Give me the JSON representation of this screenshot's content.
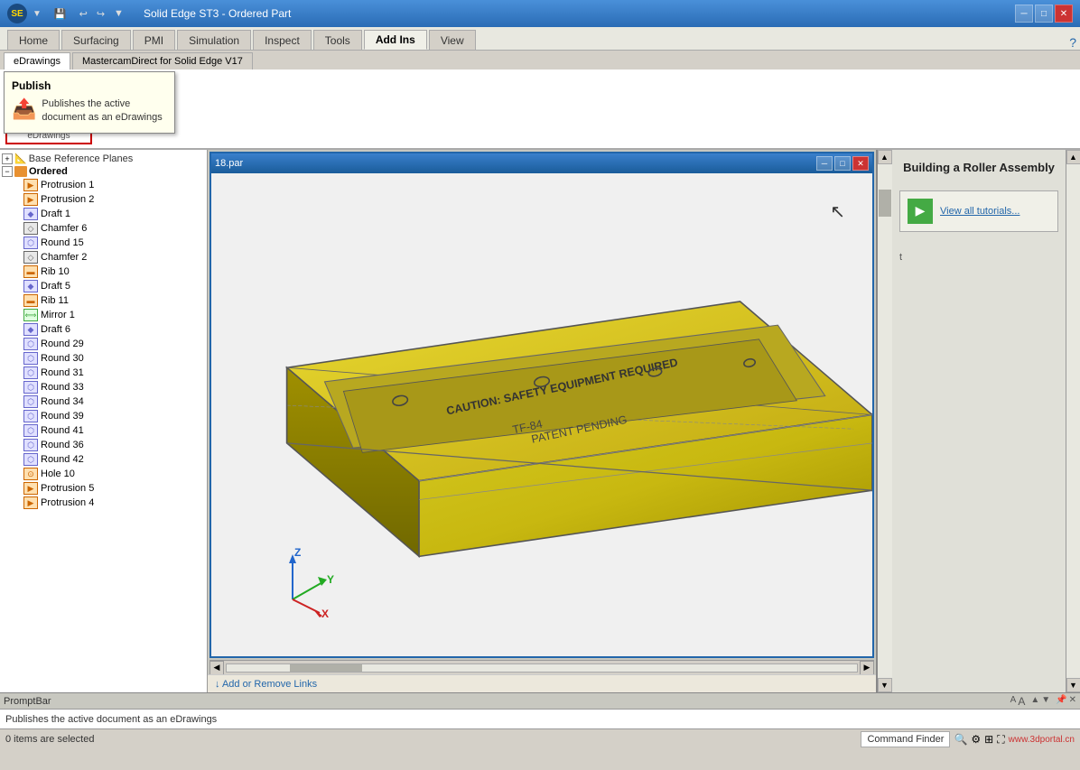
{
  "window": {
    "title": "Solid Edge ST3 - Ordered Part",
    "file_name": "18.par"
  },
  "title_bar": {
    "title": "Solid Edge ST3 - Ordered Part",
    "min_label": "─",
    "max_label": "□",
    "close_label": "✕"
  },
  "quick_access": {
    "save_label": "💾",
    "undo_label": "↩",
    "redo_label": "↪"
  },
  "ribbon": {
    "tabs": [
      {
        "id": "home",
        "label": "Home"
      },
      {
        "id": "surfacing",
        "label": "Surfacing"
      },
      {
        "id": "pmi",
        "label": "PMI"
      },
      {
        "id": "simulation",
        "label": "Simulation"
      },
      {
        "id": "inspect",
        "label": "Inspect"
      },
      {
        "id": "tools",
        "label": "Tools"
      },
      {
        "id": "addins",
        "label": "Add Ins",
        "active": true
      },
      {
        "id": "view",
        "label": "View"
      }
    ]
  },
  "toolbar": {
    "section_tabs": [
      {
        "id": "edrawings",
        "label": "eDrawings",
        "active": true
      },
      {
        "id": "mastercam",
        "label": "MastercamDirect for Solid Edge V17"
      }
    ],
    "publish_button": {
      "label": "📤",
      "tooltip_title": "Publish",
      "tooltip_text": "Publishes the active document as an eDrawings"
    }
  },
  "feature_tree": {
    "base_planes": "Base Reference Planes",
    "ordered": "Ordered",
    "items": [
      {
        "id": "protrusion1",
        "label": "Protrusion 1",
        "type": "protrusion",
        "icon": "🔷"
      },
      {
        "id": "protrusion2",
        "label": "Protrusion 2",
        "type": "protrusion",
        "icon": "🔷"
      },
      {
        "id": "draft1",
        "label": "Draft 1",
        "type": "draft",
        "icon": "🔹"
      },
      {
        "id": "chamfer6",
        "label": "Chamfer 6",
        "type": "chamfer",
        "icon": "◇"
      },
      {
        "id": "round15",
        "label": "Round 15",
        "type": "round",
        "icon": "⬡"
      },
      {
        "id": "chamfer2",
        "label": "Chamfer 2",
        "type": "chamfer",
        "icon": "◇"
      },
      {
        "id": "rib10",
        "label": "Rib 10",
        "type": "rib",
        "icon": "🔶"
      },
      {
        "id": "draft5",
        "label": "Draft 5",
        "type": "draft",
        "icon": "🔹"
      },
      {
        "id": "rib11",
        "label": "Rib 11",
        "type": "rib",
        "icon": "🔶"
      },
      {
        "id": "mirror1",
        "label": "Mirror 1",
        "type": "mirror",
        "icon": "⬜"
      },
      {
        "id": "draft6",
        "label": "Draft 6",
        "type": "draft",
        "icon": "🔹"
      },
      {
        "id": "round29",
        "label": "Round 29",
        "type": "round",
        "icon": "⬡"
      },
      {
        "id": "round30",
        "label": "Round 30",
        "type": "round",
        "icon": "⬡"
      },
      {
        "id": "round31",
        "label": "Round 31",
        "type": "round",
        "icon": "⬡"
      },
      {
        "id": "round33",
        "label": "Round 33",
        "type": "round",
        "icon": "⬡"
      },
      {
        "id": "round34",
        "label": "Round 34",
        "type": "round",
        "icon": "⬡"
      },
      {
        "id": "round39",
        "label": "Round 39",
        "type": "round",
        "icon": "⬡"
      },
      {
        "id": "round41",
        "label": "Round 41",
        "type": "round",
        "icon": "⬡"
      },
      {
        "id": "round36",
        "label": "Round 36",
        "type": "round",
        "icon": "⬡"
      },
      {
        "id": "round42",
        "label": "Round 42",
        "type": "round",
        "icon": "⬡"
      },
      {
        "id": "hole10",
        "label": "Hole 10",
        "type": "hole",
        "icon": "⭕"
      },
      {
        "id": "protrusion5",
        "label": "Protrusion 5",
        "type": "protrusion",
        "icon": "🔷"
      },
      {
        "id": "protrusion4",
        "label": "Protrusion 4",
        "type": "protrusion",
        "icon": "🔷"
      }
    ]
  },
  "viewport": {
    "filename": "18.par",
    "cursor_icon": "↖"
  },
  "tutorials": {
    "title": "Building a Roller Assembly",
    "view_all_label": "View all tutorials..."
  },
  "bottom": {
    "prompt_bar_label": "PromptBar",
    "prompt_text": "Publishes the active document as an eDrawings",
    "status_text": "0 items are selected",
    "command_finder_placeholder": "Command Finder",
    "website": "www.3dportal.cn"
  },
  "links_bar": {
    "label": "↓ Add or Remove Links"
  },
  "colors": {
    "accent_blue": "#2266aa",
    "title_blue": "#2a6cb5",
    "part_yellow": "#d4c820",
    "active_tab_orange": "#c87020",
    "toolbar_highlight_red": "#cc0000"
  }
}
